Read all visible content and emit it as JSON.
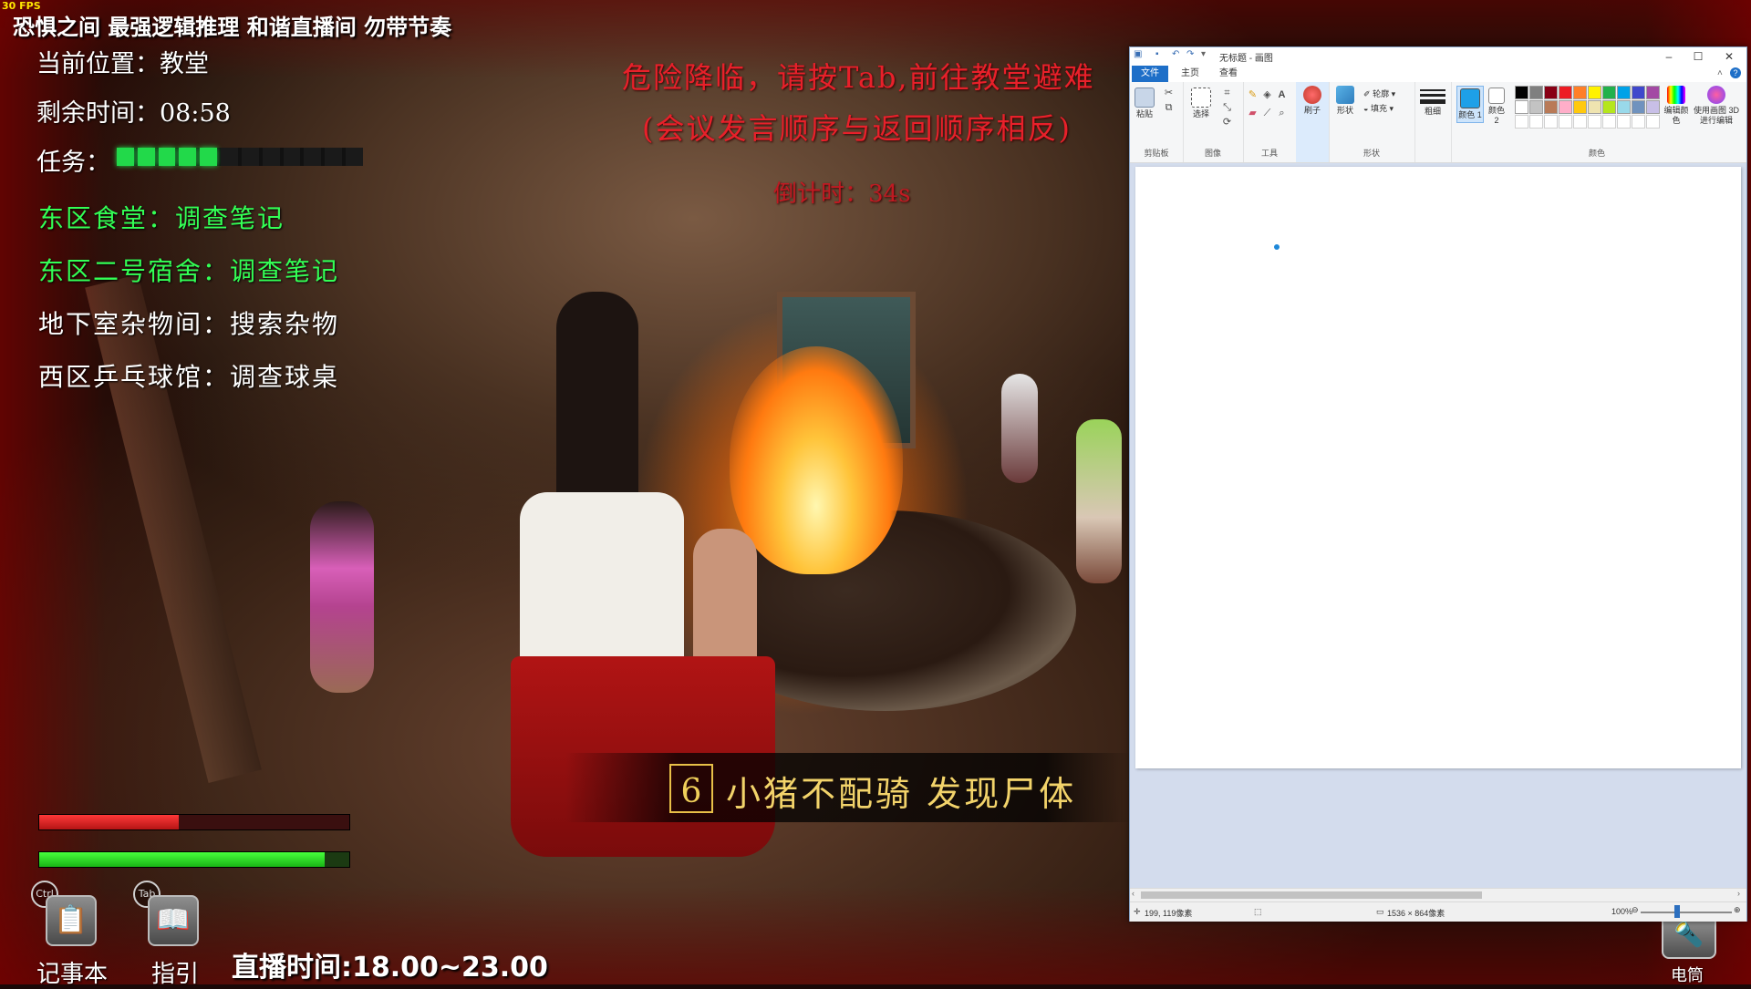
{
  "fps": "30 FPS",
  "stream_title": "恐惧之间 最强逻辑推理 和谐直播间 勿带节奏",
  "hud": {
    "location": "当前位置：教堂",
    "time_left": "剩余时间：08:58",
    "task_label": "任务：",
    "task_progress": 0.45,
    "tasks": [
      {
        "text": "东区食堂：调查笔记",
        "status": "done"
      },
      {
        "text": "东区二号宿舍：调查笔记",
        "status": "done"
      },
      {
        "text": "地下室杂物间：搜索杂物",
        "status": "pending"
      },
      {
        "text": "西区乒乓球馆：调查球桌",
        "status": "pending"
      }
    ]
  },
  "alert": {
    "line1": "危险降临，请按Tab,前往教堂避难",
    "line2": "(会议发言顺序与返回顺序相反)",
    "countdown": "倒计时：34s"
  },
  "subtitle": {
    "number": "6",
    "text": "小猪不配骑 发现尸体"
  },
  "bars": {
    "health": 0.45,
    "stamina": 0.92
  },
  "tools": [
    {
      "hotkey": "Ctrl",
      "label": "记事本",
      "icon": "notebook-icon"
    },
    {
      "hotkey": "Tab",
      "label": "指引",
      "icon": "guide-book-icon"
    }
  ],
  "stream_time": "直播时间:18.00~23.00",
  "flashlight": {
    "label": "电筒",
    "icon": "flashlight-icon"
  },
  "paint": {
    "title": "无标题 - 画图",
    "tabs": [
      "文件",
      "主页",
      "查看"
    ],
    "groups": {
      "clipboard": {
        "label": "剪贴板",
        "paste": "粘贴"
      },
      "image": {
        "label": "图像",
        "select": "选择"
      },
      "tools": {
        "label": "工具",
        "brush": "刷子"
      },
      "shapes": {
        "label": "形状",
        "shape": "形状",
        "outline": "轮廓",
        "fill": "填充"
      },
      "size": {
        "label": "粗细"
      },
      "colors": {
        "label": "颜色",
        "color1": "颜色 1",
        "color2": "颜色 2",
        "edit": "编辑颜色",
        "paint3d": "使用画图 3D 进行编辑"
      }
    },
    "color1": "#1ea0e8",
    "color2": "#ffffff",
    "palette": [
      "#000000",
      "#7f7f7f",
      "#880015",
      "#ed1c24",
      "#ff7f27",
      "#fff200",
      "#22b14c",
      "#00a2e8",
      "#3f48cc",
      "#a349a4",
      "#ffffff",
      "#c3c3c3",
      "#b97a57",
      "#ffaec9",
      "#ffc90e",
      "#efe4b0",
      "#b5e61d",
      "#99d9ea",
      "#7092be",
      "#c8bfe7"
    ],
    "status": {
      "cursor": "199, 119像素",
      "size": "1536 × 864像素",
      "zoom": "100%"
    }
  }
}
